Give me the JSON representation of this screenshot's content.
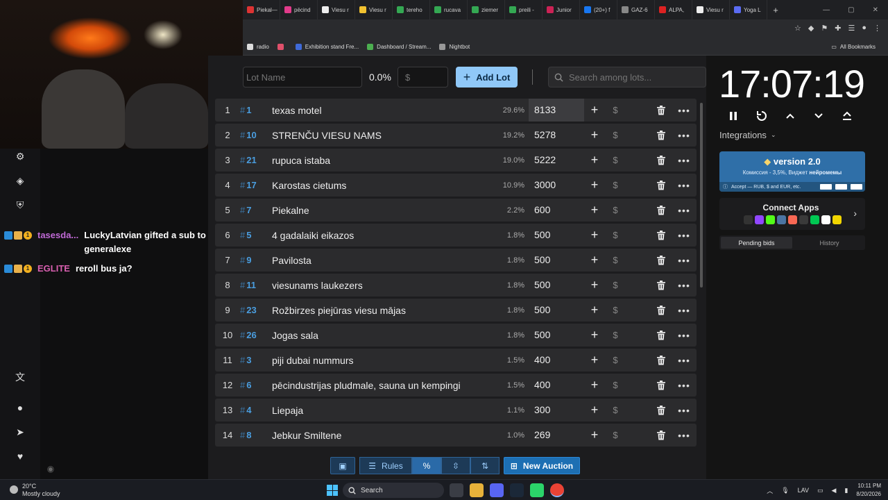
{
  "browser": {
    "tabs": [
      "Piekal—",
      "pēcind",
      "Viesu r",
      "Viesu r",
      "tereho",
      "rucava",
      "ziemer",
      "preili -",
      "Junior",
      "(20+) f",
      "GAZ-6",
      "ALPA,",
      "Viesu r",
      "Yoga L"
    ],
    "tab_colors": [
      "#d33",
      "#e23b8b",
      "#eee",
      "#f2c230",
      "#34a853",
      "#34a853",
      "#34a853",
      "#34a853",
      "#c25",
      "#1877f2",
      "#888",
      "#d22",
      "#eee",
      "#5b6cf3"
    ],
    "new_tab_icon": "+",
    "bookmarks": [
      {
        "label": "radio",
        "color": "#ddd"
      },
      {
        "label": "",
        "color": "#e0506b"
      },
      {
        "label": "Exhibition stand Fre...",
        "color": "#3f6ad8"
      },
      {
        "label": "Dashboard / Stream...",
        "color": "#4caf50"
      },
      {
        "label": "Nightbot",
        "color": "#999"
      }
    ],
    "all_bookmarks": "All Bookmarks"
  },
  "chat": [
    {
      "user": "tasesda...",
      "user_color": "#c06ad6",
      "message": "LuckyLatvian gifted a sub to generalexe",
      "badge_count": "1"
    },
    {
      "user": "EGLITE",
      "user_color": "#d95fb0",
      "message": "reroll bus ja?",
      "badge_count": "1"
    }
  ],
  "controls": {
    "lot_name_placeholder": "Lot Name",
    "percent": "0.0%",
    "amount_placeholder": "$",
    "add_lot": "Add Lot",
    "search_placeholder": "Search among lots..."
  },
  "lots": [
    {
      "idx": "1",
      "id": "1",
      "name": "texas motel",
      "pct": "29.6%",
      "amount": "8133",
      "active": true
    },
    {
      "idx": "2",
      "id": "10",
      "name": "STRENČU VIESU NAMS",
      "pct": "19.2%",
      "amount": "5278"
    },
    {
      "idx": "3",
      "id": "21",
      "name": "rupuca istaba",
      "pct": "19.0%",
      "amount": "5222"
    },
    {
      "idx": "4",
      "id": "17",
      "name": "Karostas cietums",
      "pct": "10.9%",
      "amount": "3000"
    },
    {
      "idx": "5",
      "id": "7",
      "name": "Piekalne",
      "pct": "2.2%",
      "amount": "600"
    },
    {
      "idx": "6",
      "id": "5",
      "name": "4 gadalaiki eikazos",
      "pct": "1.8%",
      "amount": "500"
    },
    {
      "idx": "7",
      "id": "9",
      "name": "Pavilosta",
      "pct": "1.8%",
      "amount": "500"
    },
    {
      "idx": "8",
      "id": "11",
      "name": " viesunams laukezers",
      "pct": "1.8%",
      "amount": "500"
    },
    {
      "idx": "9",
      "id": "23",
      "name": "Rožbirzes piejūras viesu mājas",
      "pct": "1.8%",
      "amount": "500"
    },
    {
      "idx": "10",
      "id": "26",
      "name": "Jogas sala",
      "pct": "1.8%",
      "amount": "500"
    },
    {
      "idx": "11",
      "id": "3",
      "name": "piji dubai nummurs",
      "pct": "1.5%",
      "amount": "400"
    },
    {
      "idx": "12",
      "id": "6",
      "name": "pēcindustrijas pludmale, sauna un kempingi",
      "pct": "1.5%",
      "amount": "400"
    },
    {
      "idx": "13",
      "id": "4",
      "name": "Liepaja",
      "pct": "1.1%",
      "amount": "300"
    },
    {
      "idx": "14",
      "id": "8",
      "name": "Jebkur Smiltene",
      "pct": "1.0%",
      "amount": "269"
    }
  ],
  "bottom_bar": {
    "rules": "Rules",
    "new_auction": "New Auction"
  },
  "timer": "17:07:19",
  "integrations": "Integrations",
  "donate": {
    "version": "version 2.0",
    "subtitle_plain": "Комиссия - 3,5%, Виджет ",
    "subtitle_bold": "нейромемы",
    "accept": "Accept — RUB, $ and EUR, etc."
  },
  "connect_apps": {
    "title": "Connect Apps",
    "icon_colors": [
      "#333",
      "#9147ff",
      "#53fc18",
      "#4c75a3",
      "#f96854",
      "#3a3a3a",
      "#00c853",
      "#ffffff",
      "#f2d600"
    ]
  },
  "bid_tabs": [
    "Pending bids",
    "History"
  ],
  "taskbar": {
    "temp": "20°C",
    "weather": "Mostly cloudy",
    "search": "Search",
    "lang": "LAV",
    "time": "10:11 PM",
    "date": "8/20/2026",
    "app_colors": [
      "#3a3d45",
      "#e8b23a",
      "#5865f2",
      "#1b2838",
      "#2bd46a",
      "#ea4335"
    ]
  }
}
